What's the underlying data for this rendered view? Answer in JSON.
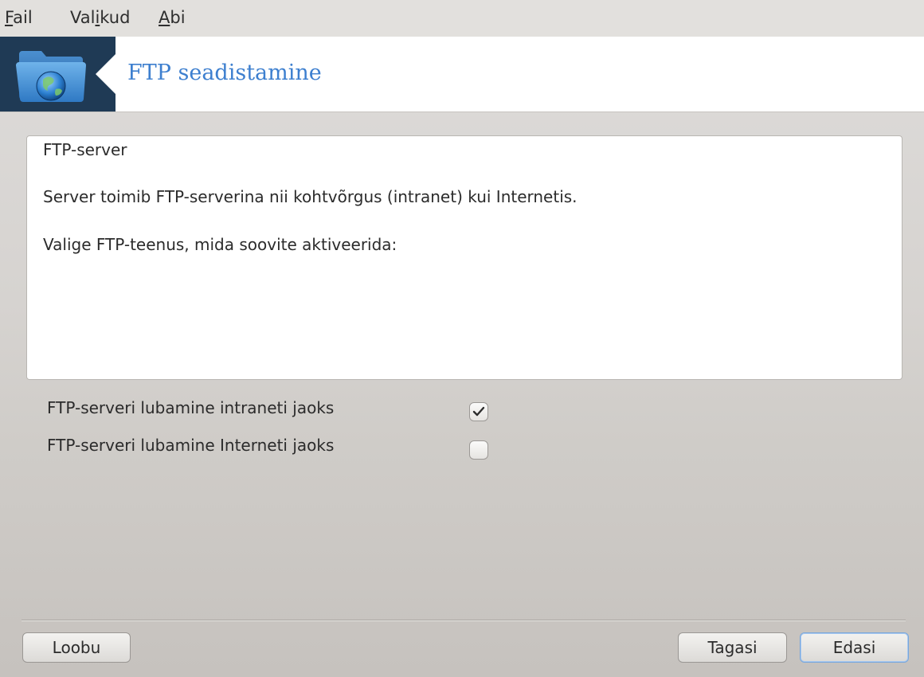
{
  "menubar": {
    "items": [
      {
        "mnemonic": "F",
        "rest": "ail"
      },
      {
        "pre": "Val",
        "mnemonic": "i",
        "rest": "kud"
      },
      {
        "mnemonic": "A",
        "rest": "bi"
      }
    ]
  },
  "banner": {
    "title": "FTP seadistamine",
    "icon": "folder-globe-icon"
  },
  "info": {
    "heading": "FTP-server",
    "description": "Server toimib FTP-serverina nii kohtvõrgus (intranet) kui Internetis.",
    "prompt": "Valige FTP-teenus, mida soovite aktiveerida:"
  },
  "options": [
    {
      "label": "FTP-serveri lubamine intraneti jaoks",
      "checked": true
    },
    {
      "label": "FTP-serveri lubamine Interneti jaoks",
      "checked": false
    }
  ],
  "buttons": {
    "cancel": "Loobu",
    "back": "Tagasi",
    "next": "Edasi"
  },
  "colors": {
    "title": "#3d7fcf",
    "banner_bg": "#1f3a55",
    "default_button_border": "#78a7dd"
  }
}
